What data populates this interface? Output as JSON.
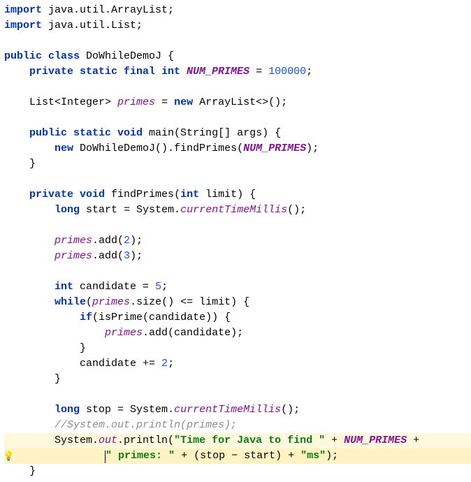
{
  "code": {
    "import1_kw": "import",
    "import1_pkg": " java.util.ArrayList;",
    "import2_kw": "import",
    "import2_pkg": " java.util.List;",
    "class_public": "public class",
    "class_name": " DoWhileDemoJ {",
    "field1_mods": "    private static final int ",
    "field1_name": "NUM_PRIMES",
    "field1_assign": " = ",
    "field1_val": "100000",
    "field1_semi": ";",
    "field2_indent": "    ",
    "field2_type": "List<Integer> ",
    "field2_name": "primes",
    "field2_assign": " = ",
    "field2_new": "new",
    "field2_ctor": " ArrayList<>();",
    "main_indent": "    ",
    "main_mods": "public static void",
    "main_sig": " main(String[] args) {",
    "main_body_indent": "        ",
    "main_new": "new",
    "main_ctor": " DoWhileDemoJ().findPrimes(",
    "main_arg": "NUM_PRIMES",
    "main_close": ");",
    "main_brace": "    }",
    "fp_indent": "    ",
    "fp_mods": "private void",
    "fp_sig": " findPrimes(",
    "fp_int": "int",
    "fp_param": " limit) {",
    "start_indent": "        ",
    "start_long": "long",
    "start_var": " start = System.",
    "start_method": "currentTimeMillis",
    "start_close": "();",
    "add2_indent": "        ",
    "add2_field": "primes",
    "add2_call": ".add(",
    "add2_val": "2",
    "add2_close": ");",
    "add3_indent": "        ",
    "add3_field": "primes",
    "add3_call": ".add(",
    "add3_val": "3",
    "add3_close": ");",
    "cand_indent": "        ",
    "cand_int": "int",
    "cand_var": " candidate = ",
    "cand_val": "5",
    "cand_semi": ";",
    "while_indent": "        ",
    "while_kw": "while",
    "while_open": "(",
    "while_field": "primes",
    "while_rest": ".size() <= limit) {",
    "if_indent": "            ",
    "if_kw": "if",
    "if_rest": "(isPrime(candidate)) {",
    "ifbody_indent": "                ",
    "ifbody_field": "primes",
    "ifbody_rest": ".add(candidate);",
    "ifclose": "            }",
    "candinc_indent": "            candidate += ",
    "candinc_val": "2",
    "candinc_semi": ";",
    "whileclose": "        }",
    "stop_indent": "        ",
    "stop_long": "long",
    "stop_var": " stop = System.",
    "stop_method": "currentTimeMillis",
    "stop_close": "();",
    "comment_indent": "        ",
    "comment_text": "//System.out.println(primes);",
    "print_indent": "        ",
    "print_sys": "System.",
    "print_out": "out",
    "print_println": ".println(",
    "print_str1": "\"Time for Java to find \"",
    "print_plus1": " + ",
    "print_np": "NUM_PRIMES",
    "print_plus2": " +",
    "print2_indent": "                ",
    "print2_str": "\" primes: \"",
    "print2_rest": " + (stop − start) + ",
    "print2_ms": "\"ms\"",
    "print2_close": ");",
    "fpclose": "    }"
  }
}
